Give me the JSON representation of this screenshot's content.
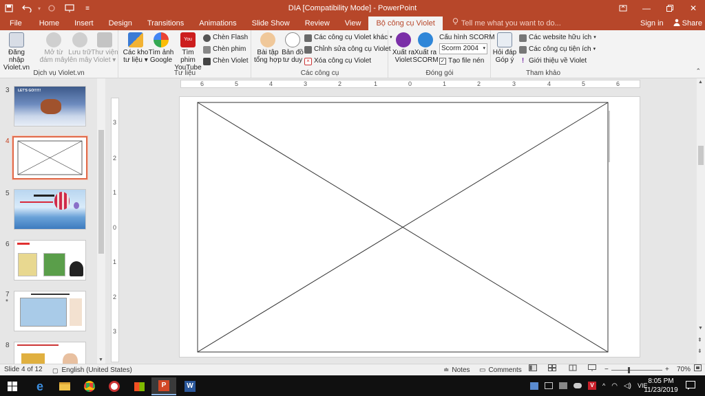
{
  "window": {
    "title": "DIA [Compatibility Mode] - PowerPoint",
    "controls": [
      "Ribbon Display Options",
      "Minimize",
      "Restore Down",
      "Close"
    ]
  },
  "tabs": [
    {
      "label": "File"
    },
    {
      "label": "Home"
    },
    {
      "label": "Insert"
    },
    {
      "label": "Design"
    },
    {
      "label": "Transitions"
    },
    {
      "label": "Animations"
    },
    {
      "label": "Slide Show"
    },
    {
      "label": "Review"
    },
    {
      "label": "View"
    },
    {
      "label": "Bộ công cụ Violet",
      "active": true
    }
  ],
  "tellme": "Tell me what you want to do...",
  "signin": "Sign in",
  "share": "Share",
  "ribbon": {
    "g1": {
      "label": "Dịch vụ Violet.vn",
      "b1": "Đăng nhập",
      "b1b": "Violet.vn",
      "b2": "Mở từ",
      "b2b": "đám mây",
      "b3": "Lưu trữ",
      "b3b": "lên mây",
      "b4": "Thư viện",
      "b4b": "Violet"
    },
    "g2": {
      "label": "Tư liệu",
      "b1": "Các kho",
      "b1b": "tư liệu",
      "b2": "Tìm ảnh",
      "b2b": "Google",
      "b3": "Tìm phim",
      "b3b": "YouTube",
      "s1": "Chèn Flash",
      "s2": "Chèn phim",
      "s3": "Chèn Violet"
    },
    "g3": {
      "label": "Các công cụ",
      "b1": "Bài tập",
      "b1b": "tổng hợp",
      "b2": "Bản đồ",
      "b2b": "tư duy",
      "s1": "Các công cụ Violet khác",
      "s2": "Chỉnh sửa công cụ Violet",
      "s3": "Xóa công cụ Violet"
    },
    "g4": {
      "label": "Đóng gói",
      "b1": "Xuất ra",
      "b1b": "Violet",
      "b2": "Xuất ra",
      "b2b": "SCORM",
      "s1": "Cấu hình SCORM",
      "combo": "Scorm 2004",
      "s3": "Tạo file nén"
    },
    "g5": {
      "label": "Tham khảo",
      "b1": "Hỏi đáp",
      "b1b": "Góp ý",
      "s1": "Các website hữu ích",
      "s2": "Các công cụ tiện ích",
      "s3": "Giới thiệu về Violet"
    }
  },
  "thumbs": [
    {
      "num": "3",
      "text": "LET'S GO!!!!!!"
    },
    {
      "num": "4",
      "selected": true
    },
    {
      "num": "5"
    },
    {
      "num": "6"
    },
    {
      "num": "7",
      "star": "*"
    },
    {
      "num": "8"
    }
  ],
  "ruler": {
    "h": [
      "6",
      "5",
      "4",
      "3",
      "2",
      "1",
      "0",
      "1",
      "2",
      "3",
      "4",
      "5",
      "6"
    ],
    "v": [
      "3",
      "2",
      "1",
      "0",
      "1",
      "2",
      "3"
    ]
  },
  "status": {
    "slide": "Slide 4 of 12",
    "lang": "English (United States)",
    "notes": "Notes",
    "comments": "Comments",
    "zoom": "70%"
  },
  "taskbar": {
    "lang": "VIE",
    "time": "8:05 PM",
    "date": "11/23/2019"
  },
  "colors": {
    "accent": "#b7472a",
    "ribbon": "#f3f3f3",
    "taskbar": "#101010"
  }
}
